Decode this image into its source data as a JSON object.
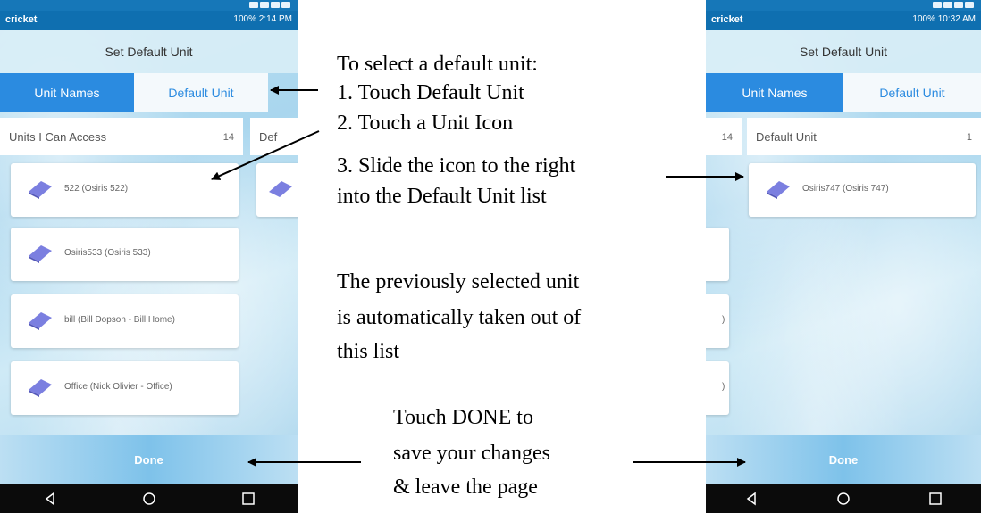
{
  "left_phone": {
    "status_carrier": "cricket",
    "status_right": "100% 2:14 PM",
    "title": "Set Default Unit",
    "tabs": [
      {
        "label": "Unit Names",
        "active": true
      },
      {
        "label": "Default Unit",
        "active": false
      }
    ],
    "list_header": {
      "label": "Units I Can Access",
      "count": "14"
    },
    "second_header_partial": "Def",
    "units": [
      "522 (Osiris 522)",
      "Osiris533 (Osiris 533)",
      "bill (Bill Dopson - Bill Home)",
      "Office (Nick Olivier - Office)"
    ],
    "done_label": "Done"
  },
  "right_phone": {
    "status_carrier": "cricket",
    "status_right": "100% 10:32 AM",
    "title": "Set Default Unit",
    "tabs": [
      {
        "label": "Unit Names",
        "active": true
      },
      {
        "label": "Default Unit",
        "active": false
      }
    ],
    "left_count_partial": "14",
    "list_header": {
      "label": "Default Unit",
      "count": "1"
    },
    "default_units": [
      "Osiris747 (Osiris 747)"
    ],
    "partial_fragments": [
      ")",
      ")"
    ],
    "done_label": "Done"
  },
  "annotations": {
    "step_title": "To select a default unit:",
    "step1": "1. Touch Default Unit",
    "step2": "2. Touch a Unit Icon",
    "step3a": "3. Slide the icon to the right",
    "step3b": "into the Default Unit list",
    "note1": "The previously selected unit",
    "note2": "is automatically taken out of",
    "note3": "this list",
    "done1": "Touch DONE to",
    "done2": "save your changes",
    "done3": "& leave the page"
  },
  "colors": {
    "accent": "#2b8be0",
    "status_bar": "#0f6fb0",
    "unit_icon": "#7b7fe0",
    "nav_bar": "#0b0b0b"
  },
  "icons": [
    "unit-icon",
    "back-icon",
    "home-icon",
    "recents-icon",
    "wifi-icon",
    "battery-icon"
  ]
}
